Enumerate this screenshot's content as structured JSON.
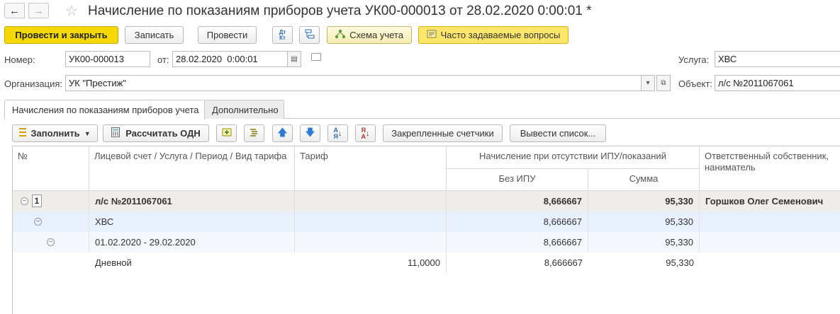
{
  "window": {
    "title": "Начисление по показаниям приборов учета УК00-000013 от 28.02.2020 0:00:01 *"
  },
  "commands": {
    "post_and_close": "Провести и закрыть",
    "write": "Записать",
    "post": "Провести",
    "dt_kt": "Дт Кт",
    "schema": "Схема учета",
    "faq": "Часто задаваемые вопросы"
  },
  "form": {
    "number_label": "Номер:",
    "number_value": "УК00-000013",
    "date_label": "от:",
    "date_value": "28.02.2020  0:00:01",
    "org_label": "Организация:",
    "org_value": "УК \"Престиж\"",
    "service_label": "Услуга:",
    "service_value": "ХВС",
    "object_label": "Объект:",
    "object_value": "л/с №2011067061"
  },
  "tabs": [
    {
      "label": "Начисления по показаниям приборов учета",
      "active": true
    },
    {
      "label": "Дополнительно",
      "active": false
    }
  ],
  "table_toolbar": {
    "fill": "Заполнить",
    "calc_odn": "Рассчитать ОДН",
    "pinned_meters": "Закрепленные счетчики",
    "output_list": "Вывести список..."
  },
  "table": {
    "headers": {
      "num": "№",
      "account": "Лицевой счет / Услуга / Период / Вид тарифа",
      "tariff": "Тариф",
      "accrual_group": "Начисление при отсутствии ИПУ/показаний",
      "without_ipu": "Без ИПУ",
      "sum": "Сумма",
      "owner": "Ответственный собственник, наниматель"
    },
    "rows": [
      {
        "num": "1",
        "account": "л/с №2011067061",
        "tariff": "",
        "without_ipu": "8,666667",
        "sum": "95,330",
        "owner": "Горшков Олег Семенович"
      },
      {
        "num": "",
        "account": "ХВС",
        "tariff": "",
        "without_ipu": "8,666667",
        "sum": "95,330",
        "owner": ""
      },
      {
        "num": "",
        "account": "01.02.2020 - 29.02.2020",
        "tariff": "",
        "without_ipu": "8,666667",
        "sum": "95,330",
        "owner": ""
      },
      {
        "num": "",
        "account": "Дневной",
        "tariff": "11,0000",
        "without_ipu": "8,666667",
        "sum": "95,330",
        "owner": ""
      }
    ]
  },
  "colors": {
    "primary_button": "#f5d800",
    "faq_button": "#fbe66b",
    "group_row": "#eeede9",
    "level1_row": "#e8f0fb",
    "level2_row": "#f4f8fd"
  }
}
